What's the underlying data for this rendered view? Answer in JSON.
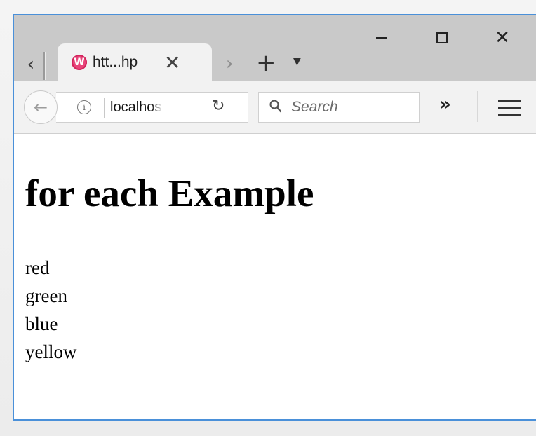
{
  "browser": {
    "tab": {
      "title": "htt...hp",
      "close_glyph": "✕",
      "favicon_letter": "W"
    },
    "tabstrip": {
      "scroll_left_glyph": "‹",
      "scroll_right_glyph": "›",
      "new_tab_glyph": "+",
      "tab_list_glyph": "▼"
    },
    "window_controls": {
      "close_glyph": "✕"
    },
    "toolbar": {
      "back_glyph": "←",
      "info_glyph": "i",
      "url": "localhost",
      "reload_glyph": "↻",
      "search_placeholder": "Search",
      "overflow_glyph": "»"
    },
    "colors": {
      "accent_border": "#4a90d9",
      "favicon": "#e8457a",
      "tabstrip": "#c9c9c9",
      "toolbar": "#f2f2f2"
    },
    "icons": [
      "tab-favicon-icon",
      "close-tab-icon",
      "back-arrow-icon",
      "info-icon",
      "reload-icon",
      "search-icon",
      "overflow-chevron-icon",
      "hamburger-menu-icon",
      "minimize-icon",
      "maximize-icon",
      "close-window-icon"
    ]
  },
  "page": {
    "heading": "for each Example",
    "items": [
      "red",
      "green",
      "blue",
      "yellow"
    ]
  }
}
